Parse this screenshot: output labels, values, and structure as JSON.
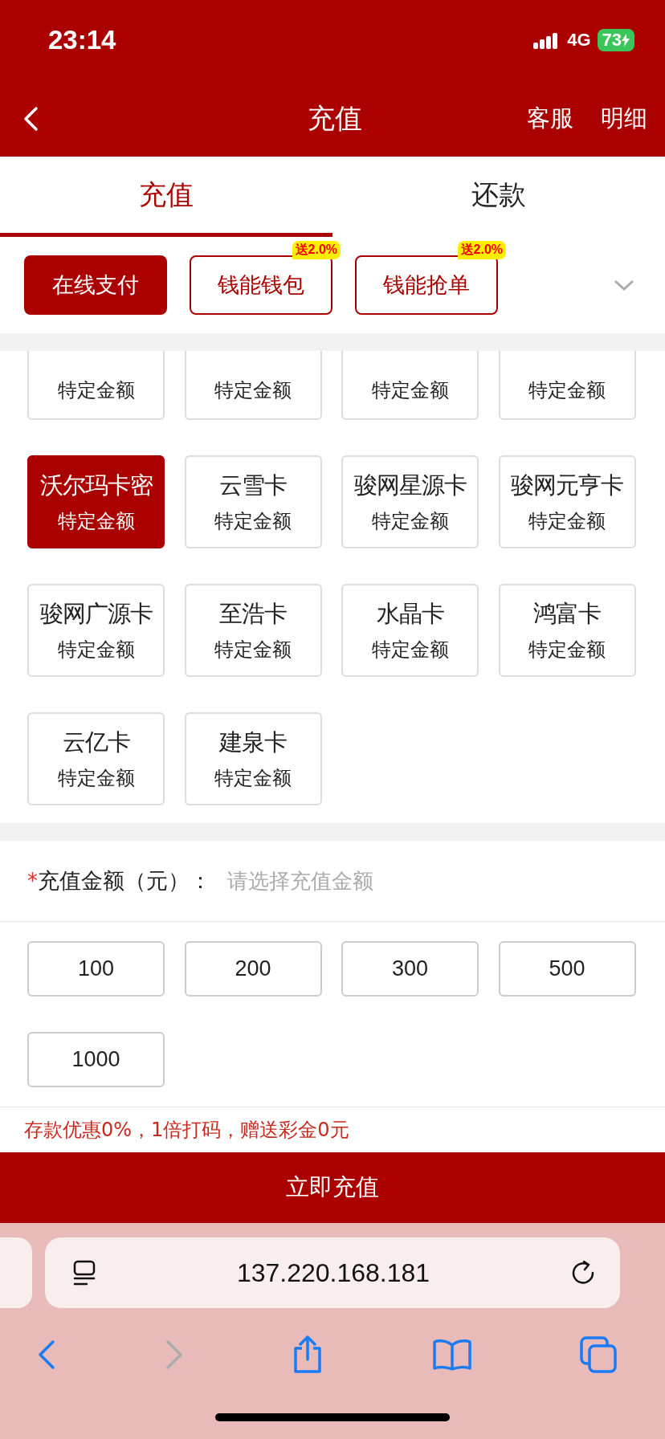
{
  "status_bar": {
    "time": "23:14",
    "network": "4G",
    "battery": "73"
  },
  "nav": {
    "title": "充值",
    "actions": [
      "客服",
      "明细"
    ]
  },
  "tabs": [
    {
      "label": "充值",
      "selected": true
    },
    {
      "label": "还款",
      "selected": false
    }
  ],
  "pay_methods": [
    {
      "label": "在线支付",
      "selected": true
    },
    {
      "label": "钱能钱包",
      "selected": false,
      "badge": "送2.0%"
    },
    {
      "label": "钱能抢单",
      "selected": false,
      "badge": "送2.0%"
    }
  ],
  "cards": [
    {
      "sub": "特定金额",
      "selected": false
    },
    {
      "sub": "特定金额",
      "selected": false
    },
    {
      "sub": "特定金额",
      "selected": false
    },
    {
      "sub": "特定金额",
      "selected": false
    },
    {
      "name": "沃尔玛卡密",
      "sub": "特定金额",
      "selected": true
    },
    {
      "name": "云雪卡",
      "sub": "特定金额",
      "selected": false
    },
    {
      "name": "骏网星源卡",
      "sub": "特定金额",
      "selected": false
    },
    {
      "name": "骏网元亨卡",
      "sub": "特定金额",
      "selected": false
    },
    {
      "name": "骏网广源卡",
      "sub": "特定金额",
      "selected": false
    },
    {
      "name": "至浩卡",
      "sub": "特定金额",
      "selected": false
    },
    {
      "name": "水晶卡",
      "sub": "特定金额",
      "selected": false
    },
    {
      "name": "鸿富卡",
      "sub": "特定金额",
      "selected": false
    },
    {
      "name": "云亿卡",
      "sub": "特定金额",
      "selected": false
    },
    {
      "name": "建泉卡",
      "sub": "特定金额",
      "selected": false
    }
  ],
  "amount": {
    "required_mark": "*",
    "label": "充值金额（元）：",
    "placeholder": "请选择充值金额"
  },
  "amount_options": [
    {
      "label": "100",
      "selected": false
    },
    {
      "label": "200",
      "selected": false
    },
    {
      "label": "300",
      "selected": false
    },
    {
      "label": "500",
      "selected": false
    },
    {
      "label": "1000",
      "selected": false
    }
  ],
  "note": "存款优惠0%，1倍打码，赠送彩金0元",
  "submit": "立即充值",
  "browser": {
    "url": "137.220.168.181"
  }
}
